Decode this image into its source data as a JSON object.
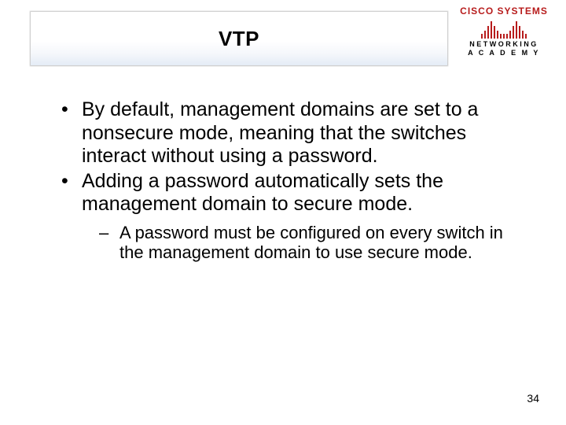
{
  "slide": {
    "title": "VTP",
    "bullets": [
      "By default, management domains are set to a nonsecure mode, meaning that the switches interact without using a password.",
      "Adding a password automatically sets the management domain to secure mode."
    ],
    "sub_bullets": [
      "A password must be configured on every switch in the management domain to use secure mode."
    ],
    "page_number": "34"
  },
  "logo": {
    "brand": "CISCO SYSTEMS",
    "sub1": "NETWORKING",
    "sub2": "A C A D E M Y"
  }
}
